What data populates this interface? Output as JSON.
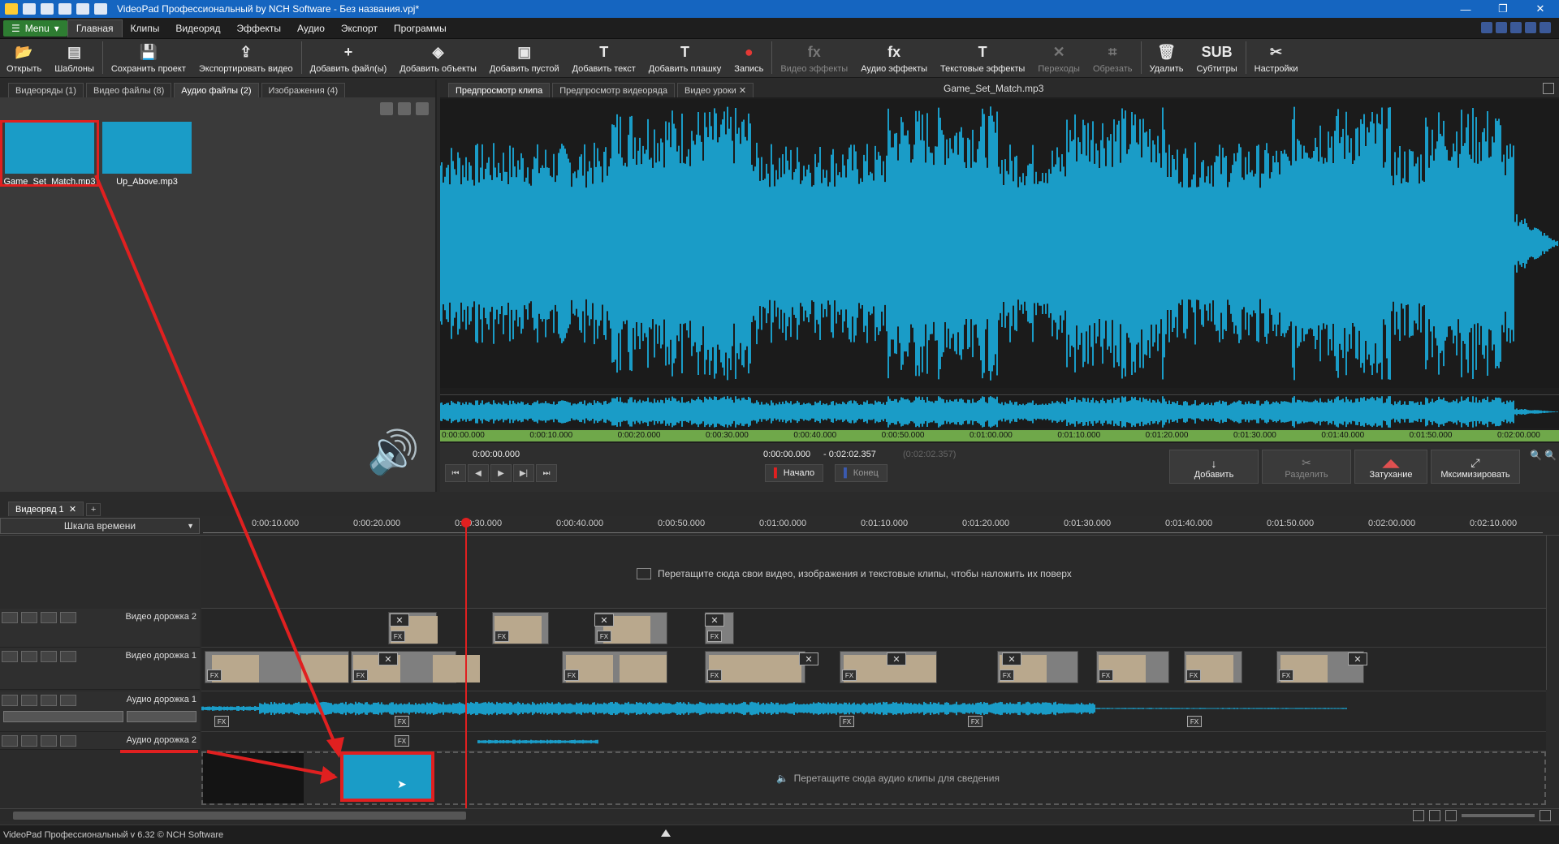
{
  "window": {
    "title": "VideoPad Профессиональный by NCH Software - Без названия.vpj*",
    "controls": [
      "—",
      "❐",
      "✕"
    ]
  },
  "menu": {
    "menu_button": "Menu",
    "tabs": [
      "Главная",
      "Клипы",
      "Видеоряд",
      "Эффекты",
      "Аудио",
      "Экспорт",
      "Программы"
    ],
    "active_tab": "Главная"
  },
  "toolbar": {
    "items": [
      {
        "label": "Открыть",
        "icon": "folder-open-icon",
        "glyph": "📂",
        "enabled": true
      },
      {
        "label": "Шаблоны",
        "icon": "templates-icon",
        "glyph": "▤",
        "enabled": true
      },
      {
        "label": "Сохранить проект",
        "icon": "save-icon",
        "glyph": "💾",
        "enabled": true
      },
      {
        "label": "Экспортировать видео",
        "icon": "export-icon",
        "glyph": "⇪",
        "enabled": true
      },
      {
        "label": "Добавить файл(ы)",
        "icon": "add-files-icon",
        "glyph": "+",
        "enabled": true
      },
      {
        "label": "Добавить объекты",
        "icon": "add-objects-icon",
        "glyph": "◈",
        "enabled": true
      },
      {
        "label": "Добавить пустой",
        "icon": "add-blank-icon",
        "glyph": "▣",
        "enabled": true
      },
      {
        "label": "Добавить текст",
        "icon": "add-text-icon",
        "glyph": "T",
        "enabled": true
      },
      {
        "label": "Добавить плашку",
        "icon": "add-caption-icon",
        "glyph": "T",
        "enabled": true
      },
      {
        "label": "Запись",
        "icon": "record-icon",
        "glyph": "●",
        "enabled": true
      },
      {
        "label": "Видео эффекты",
        "icon": "video-effects-icon",
        "glyph": "fx",
        "enabled": false
      },
      {
        "label": "Аудио эффекты",
        "icon": "audio-effects-icon",
        "glyph": "fx",
        "enabled": true
      },
      {
        "label": "Текстовые эффекты",
        "icon": "text-effects-icon",
        "glyph": "T",
        "enabled": true
      },
      {
        "label": "Переходы",
        "icon": "transitions-icon",
        "glyph": "✕",
        "enabled": false
      },
      {
        "label": "Обрезать",
        "icon": "crop-icon",
        "glyph": "⌗",
        "enabled": false
      },
      {
        "label": "Удалить",
        "icon": "delete-icon",
        "glyph": "🗑",
        "enabled": true
      },
      {
        "label": "Субтитры",
        "icon": "subtitles-icon",
        "glyph": "SUB",
        "enabled": true
      },
      {
        "label": "Настройки",
        "icon": "settings-icon",
        "glyph": "✂",
        "enabled": true
      }
    ]
  },
  "bin": {
    "tabs": [
      {
        "label": "Видеоряды",
        "count": "(1)"
      },
      {
        "label": "Видео файлы",
        "count": "(8)"
      },
      {
        "label": "Аудио файлы",
        "count": "(2)"
      },
      {
        "label": "Изображения",
        "count": "(4)"
      }
    ],
    "active_tab": "Аудио файлы",
    "files": [
      {
        "name": "Game_Set_Match.mp3",
        "selected": true
      },
      {
        "name": "Up_Above.mp3",
        "selected": false
      }
    ]
  },
  "preview": {
    "tabs": [
      "Предпросмотр клипа",
      "Предпросмотр видеоряда",
      "Видео уроки"
    ],
    "active_tab": "Предпросмотр клипа",
    "tab_close": "✕",
    "filename": "Game_Set_Match.mp3",
    "ruler_labels": [
      "0:00:00.000",
      "0:00:10.000",
      "0:00:20.000",
      "0:00:30.000",
      "0:00:40.000",
      "0:00:50.000",
      "0:01:00.000",
      "0:01:10.000",
      "0:01:20.000",
      "0:01:30.000",
      "0:01:40.000",
      "0:01:50.000",
      "0:02:00.000"
    ],
    "current_time": "0:00:00.000",
    "start_time": "0:00:00.000",
    "range_separator": "-",
    "end_time": "0:02:02.357",
    "duration": "(0:02:02.357)",
    "transport": [
      "⏮",
      "◀",
      "▶",
      "▶|",
      "⏭"
    ],
    "mark_start": "Начало",
    "mark_end": "Конец",
    "actions": [
      {
        "label": "Добавить",
        "enabled": true
      },
      {
        "label": "Разделить",
        "enabled": false
      },
      {
        "label": "Затухание",
        "enabled": true
      },
      {
        "label": "Мксимизировать",
        "enabled": true
      }
    ],
    "accent": "#1a9cc7"
  },
  "timeline": {
    "tab": "Видеоряд 1",
    "tab_close": "✕",
    "add_tab": "+",
    "scale_label": "Шкала времени",
    "ticks": [
      "0:00:10.000",
      "0:00:20.000",
      "0:00:30.000",
      "0:00:40.000",
      "0:00:50.000",
      "0:01:00.000",
      "0:01:10.000",
      "0:01:20.000",
      "0:01:30.000",
      "0:01:40.000",
      "0:01:50.000",
      "0:02:00.000",
      "0:02:10.000"
    ],
    "overlay_hint": "Перетащите сюда свои видео, изображения и текстовые клипы, чтобы наложить их поверх",
    "tracks": {
      "video2": "Видео дорожка 2",
      "video1": "Видео дорожка 1",
      "audio1": "Аудио дорожка 1",
      "audio2": "Аудио дорожка 2"
    },
    "fx_label": "FX",
    "transition_glyph": "✕",
    "audio_drop_hint": "Перетащите сюда аудио клипы для сведения",
    "playhead_color": "#e02020"
  },
  "status": {
    "text": "VideoPad Профессиональный v 6.32 © NCH Software"
  }
}
